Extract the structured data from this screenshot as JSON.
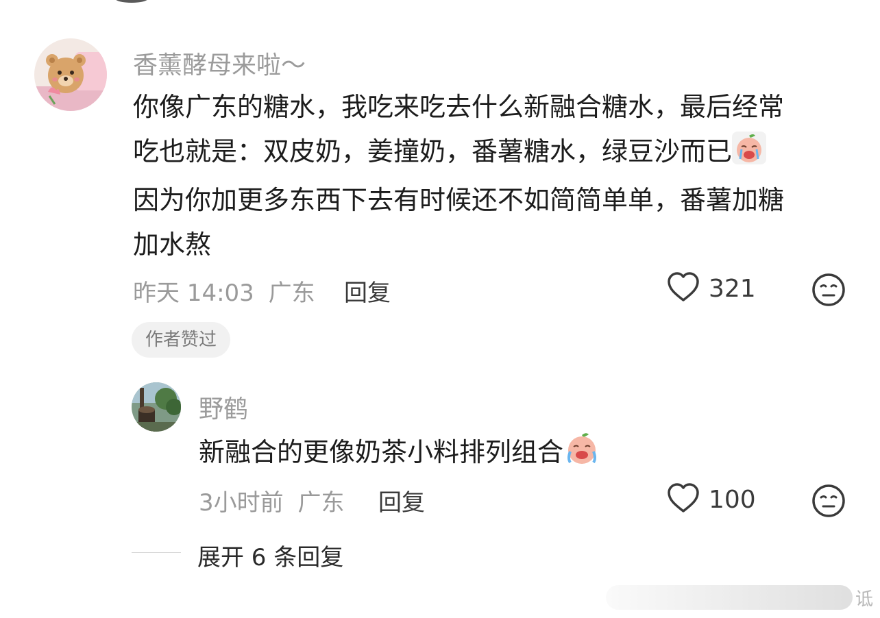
{
  "comment": {
    "username": "香薰酵母来啦～",
    "text_lines": [
      "你像广东的糖水，我吃来吃去什么新融合糖水，最后经常",
      "吃也就是：双皮奶，姜撞奶，番薯糖水，绿豆沙而已",
      "因为你加更多东西下去有时候还不如简简单单，番薯加糖",
      "加水熬"
    ],
    "time": "昨天 14:03",
    "location": "广东",
    "reply_label": "回复",
    "like_count": "321",
    "author_badge": "作者赞过"
  },
  "reply": {
    "username": "野鹤",
    "text": "新融合的更像奶茶小料排列组合",
    "time": "3小时前",
    "location": "广东",
    "reply_label": "回复",
    "like_count": "100"
  },
  "expand": {
    "label": "展开 6 条回复"
  },
  "watermark": {
    "text": "诋"
  },
  "icons": {
    "like": "heart-outline-icon",
    "dislike": "neutral-face-icon",
    "emoji": "crying-peach-emoji"
  },
  "colors": {
    "muted_text": "#9b9b9b",
    "body_text": "#1c1c1c",
    "badge_bg": "#f1f1f1"
  }
}
